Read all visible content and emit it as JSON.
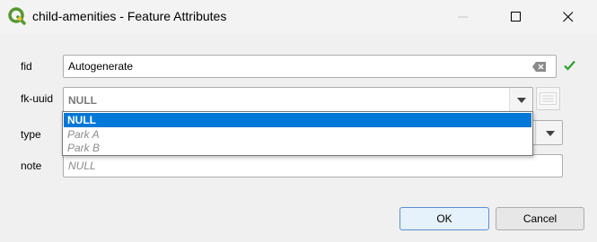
{
  "window": {
    "title": "child-amenities - Feature Attributes",
    "app_icon": "qgis-icon"
  },
  "form": {
    "fid": {
      "label": "fid",
      "value": "Autogenerate"
    },
    "fk_uuid": {
      "label": "fk-uuid",
      "value": "NULL",
      "options": [
        "NULL",
        "Park A",
        "Park B"
      ]
    },
    "type": {
      "label": "type"
    },
    "note": {
      "label": "note",
      "value": "NULL"
    }
  },
  "buttons": {
    "ok": "OK",
    "cancel": "Cancel"
  },
  "colors": {
    "selection": "#0078d7",
    "check": "#2e9e2e",
    "null_text": "#8a8a8a",
    "qgis_green": "#589632",
    "qgis_yellow": "#ee7913"
  }
}
